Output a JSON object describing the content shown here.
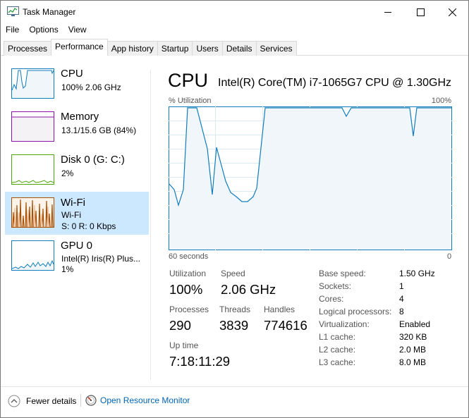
{
  "window": {
    "title": "Task Manager"
  },
  "menu": {
    "file": "File",
    "options": "Options",
    "view": "View"
  },
  "tabs": [
    "Processes",
    "Performance",
    "App history",
    "Startup",
    "Users",
    "Details",
    "Services"
  ],
  "active_tab": "Performance",
  "sidebar": {
    "items": [
      {
        "title": "CPU",
        "line1": "100%  2.06 GHz",
        "line2": "",
        "color": "#117dbb",
        "fill": "#f1f6fa"
      },
      {
        "title": "Memory",
        "line1": "13.1/15.6 GB (84%)",
        "line2": "",
        "color": "#8b12ae",
        "fill": "#f4f2f4"
      },
      {
        "title": "Disk 0 (G: C:)",
        "line1": "2%",
        "line2": "",
        "color": "#4da60c",
        "fill": "#eff7e9"
      },
      {
        "title": "Wi-Fi",
        "line1": "Wi-Fi",
        "line2": "S: 0  R: 0 Kbps",
        "color": "#a74f01",
        "fill": "#fcf3eb"
      },
      {
        "title": "GPU 0",
        "line1": "Intel(R) Iris(R) Plus...",
        "line2": "1%",
        "color": "#117dbb",
        "fill": "#f1f6fa"
      }
    ]
  },
  "main": {
    "title": "CPU",
    "model": "Intel(R) Core(TM) i7-1065G7 CPU @ 1.30GHz",
    "graph": {
      "y_label": "% Utilization",
      "y_max_label": "100%",
      "x_label": "60 seconds",
      "x_min_label": "0",
      "line_color": "#117dbb",
      "fill_color": "#f1f6fa",
      "grid_color": "#d9eaf4"
    },
    "stats": {
      "utilization_label": "Utilization",
      "utilization": "100%",
      "speed_label": "Speed",
      "speed": "2.06 GHz",
      "processes_label": "Processes",
      "processes": "290",
      "threads_label": "Threads",
      "threads": "3839",
      "handles_label": "Handles",
      "handles": "774616",
      "uptime_label": "Up time",
      "uptime": "7:18:11:29"
    },
    "specs": [
      {
        "label": "Base speed:",
        "value": "1.50 GHz"
      },
      {
        "label": "Sockets:",
        "value": "1"
      },
      {
        "label": "Cores:",
        "value": "4"
      },
      {
        "label": "Logical processors:",
        "value": "8"
      },
      {
        "label": "Virtualization:",
        "value": "Enabled"
      },
      {
        "label": "L1 cache:",
        "value": "320 KB"
      },
      {
        "label": "L2 cache:",
        "value": "2.0 MB"
      },
      {
        "label": "L3 cache:",
        "value": "8.0 MB"
      }
    ]
  },
  "footer": {
    "fewer_details": "Fewer details",
    "open_resource_monitor": "Open Resource Monitor"
  },
  "icons": {
    "app": "task-manager-icon",
    "minimize": "minimize-icon",
    "maximize": "maximize-icon",
    "close": "close-icon",
    "fewer": "chevron-up-circle-icon",
    "resmon": "resource-monitor-icon"
  }
}
